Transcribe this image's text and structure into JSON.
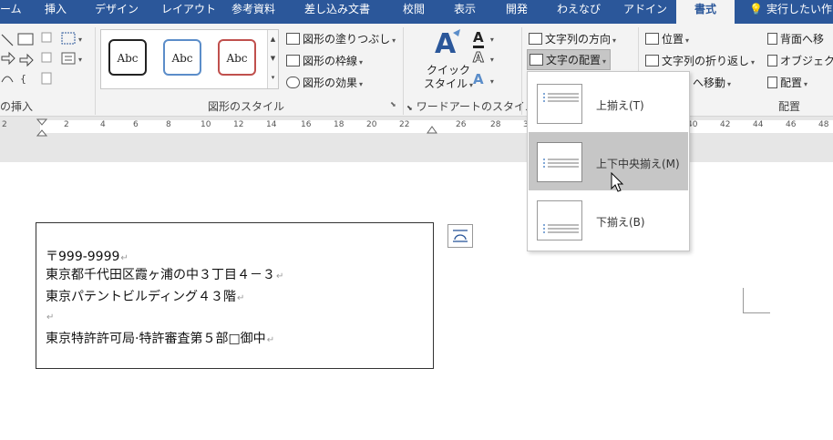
{
  "tabs": [
    "ーム",
    "挿入",
    "デザイン",
    "レイアウト",
    "参考資料",
    "差し込み文書",
    "校閲",
    "表示",
    "開発",
    "わえなび",
    "アドイン"
  ],
  "active_tab": "書式",
  "tell_me": "実行したい作",
  "ribbon": {
    "insert_shapes_label": "の挿入",
    "gallery_samples": [
      "Abc",
      "Abc",
      "Abc"
    ],
    "shape_fill": "図形の塗りつぶし",
    "shape_outline": "図形の枠線",
    "shape_effects": "図形の効果",
    "shape_styles_label": "図形のスタイル",
    "quick_style_line1": "クイック",
    "quick_style_line2": "スタイル",
    "wordart_label": "ワードアートのスタイル",
    "text_direction": "文字列の方向",
    "text_align": "文字の配置",
    "position": "位置",
    "wrap_text": "文字列の折り返し",
    "bring_forward": "背面へ移",
    "selection_pane": "オブジェクト",
    "send_backward": "へ移動",
    "align": "配置",
    "arrange_label": "配置"
  },
  "ruler": {
    "numbers": [
      "2",
      "2",
      "4",
      "6",
      "8",
      "10",
      "12",
      "14",
      "16",
      "18",
      "20",
      "22",
      "26",
      "28",
      "30",
      "32",
      "34",
      "36",
      "38",
      "40",
      "42",
      "44",
      "46",
      "48"
    ]
  },
  "textbox": {
    "lines": [
      "〒999-9999",
      "東京都千代田区霞ヶ浦の中３丁目４－３",
      "東京パテントビルディング４３階",
      "",
      "東京特許許可局·特許審査第５部□御中"
    ]
  },
  "dropdown": {
    "items": [
      {
        "label": "上揃え(T)"
      },
      {
        "label": "上下中央揃え(M)"
      },
      {
        "label": "下揃え(B)"
      }
    ]
  },
  "colors": {
    "tab_bar": "#2b579a",
    "ribbon_bg": "#f3f3f3",
    "hover": "#c6c6c6"
  }
}
